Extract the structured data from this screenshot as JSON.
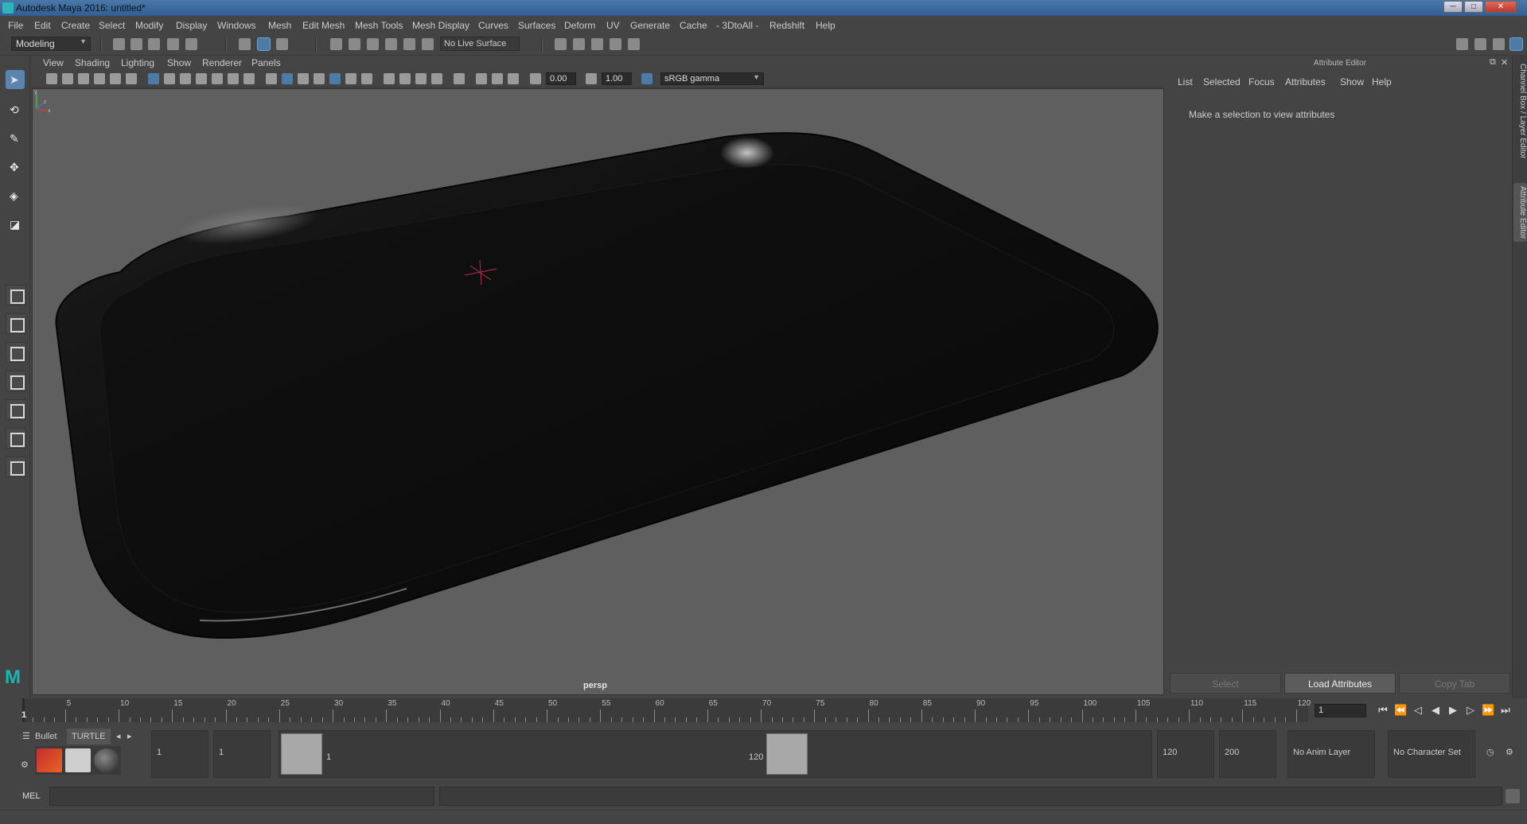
{
  "window": {
    "title": "Autodesk Maya 2016: untitled*",
    "minimize": "─",
    "maximize": "□",
    "close": "✕"
  },
  "menubar": [
    "File",
    "Edit",
    "Create",
    "Select",
    "Modify",
    "Display",
    "Windows",
    "Mesh",
    "Edit Mesh",
    "Mesh Tools",
    "Mesh Display",
    "Curves",
    "Surfaces",
    "Deform",
    "UV",
    "Generate",
    "Cache",
    "- 3DtoAll -",
    "Redshift",
    "Help"
  ],
  "toolbar": {
    "mode": "Modeling",
    "live_surface": "No Live Surface"
  },
  "viewport": {
    "menu": [
      "View",
      "Shading",
      "Lighting",
      "Show",
      "Renderer",
      "Panels"
    ],
    "exposure": "0.00",
    "gamma": "1.00",
    "color_space": "sRGB gamma",
    "camera_label": "persp",
    "axis_x": "x",
    "axis_y": "y",
    "axis_z": "z"
  },
  "attribute_editor": {
    "title": "Attribute Editor",
    "menu": [
      "List",
      "Selected",
      "Focus",
      "Attributes",
      "Show",
      "Help"
    ],
    "message": "Make a selection to view attributes",
    "buttons": {
      "select": "Select",
      "load": "Load Attributes",
      "copy": "Copy Tab"
    }
  },
  "side_tabs": {
    "channel_box": "Channel Box / Layer Editor",
    "attribute_editor": "Attribute Editor"
  },
  "timeline": {
    "ticks": [
      "5",
      "10",
      "15",
      "20",
      "25",
      "30",
      "35",
      "40",
      "45",
      "50",
      "55",
      "60",
      "65",
      "70",
      "75",
      "80",
      "85",
      "90",
      "95",
      "100",
      "105",
      "110",
      "115",
      "120"
    ],
    "current_frame_label": "1",
    "current_frame_field": "1"
  },
  "shelf": {
    "tabs": [
      "Bullet",
      "TURTLE"
    ]
  },
  "range": {
    "start_time": "1",
    "playback_start": "1",
    "range_start_label": "1",
    "range_end_label": "120",
    "playback_end": "120",
    "end_time": "200",
    "anim_layer": "No Anim Layer",
    "character_set": "No Character Set"
  },
  "command_line": {
    "label": "MEL"
  },
  "colors": {
    "accent": "#5a85b2",
    "viewport_bg": "#5f5f5f",
    "maya_teal": "#1fb4b4"
  }
}
